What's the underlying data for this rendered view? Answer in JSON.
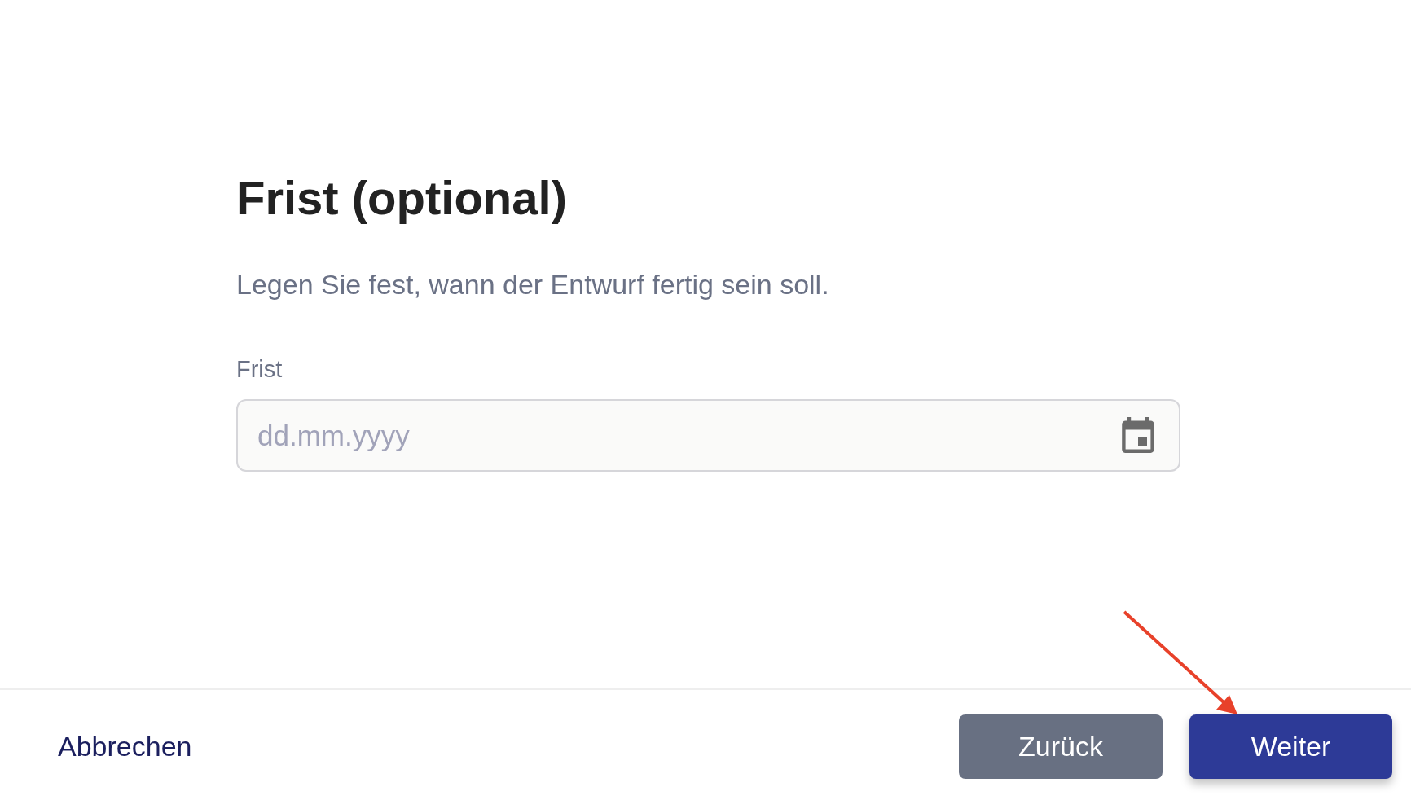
{
  "form": {
    "title": "Frist (optional)",
    "description": "Legen Sie fest, wann der Entwurf fertig sein soll.",
    "field": {
      "label": "Frist",
      "placeholder": "dd.mm.yyyy"
    }
  },
  "footer": {
    "buttons": [
      {
        "label": "Abbrechen",
        "kind": "link"
      },
      {
        "label": "Zurück",
        "kind": "secondary"
      },
      {
        "label": "Weiter",
        "kind": "primary"
      }
    ]
  }
}
